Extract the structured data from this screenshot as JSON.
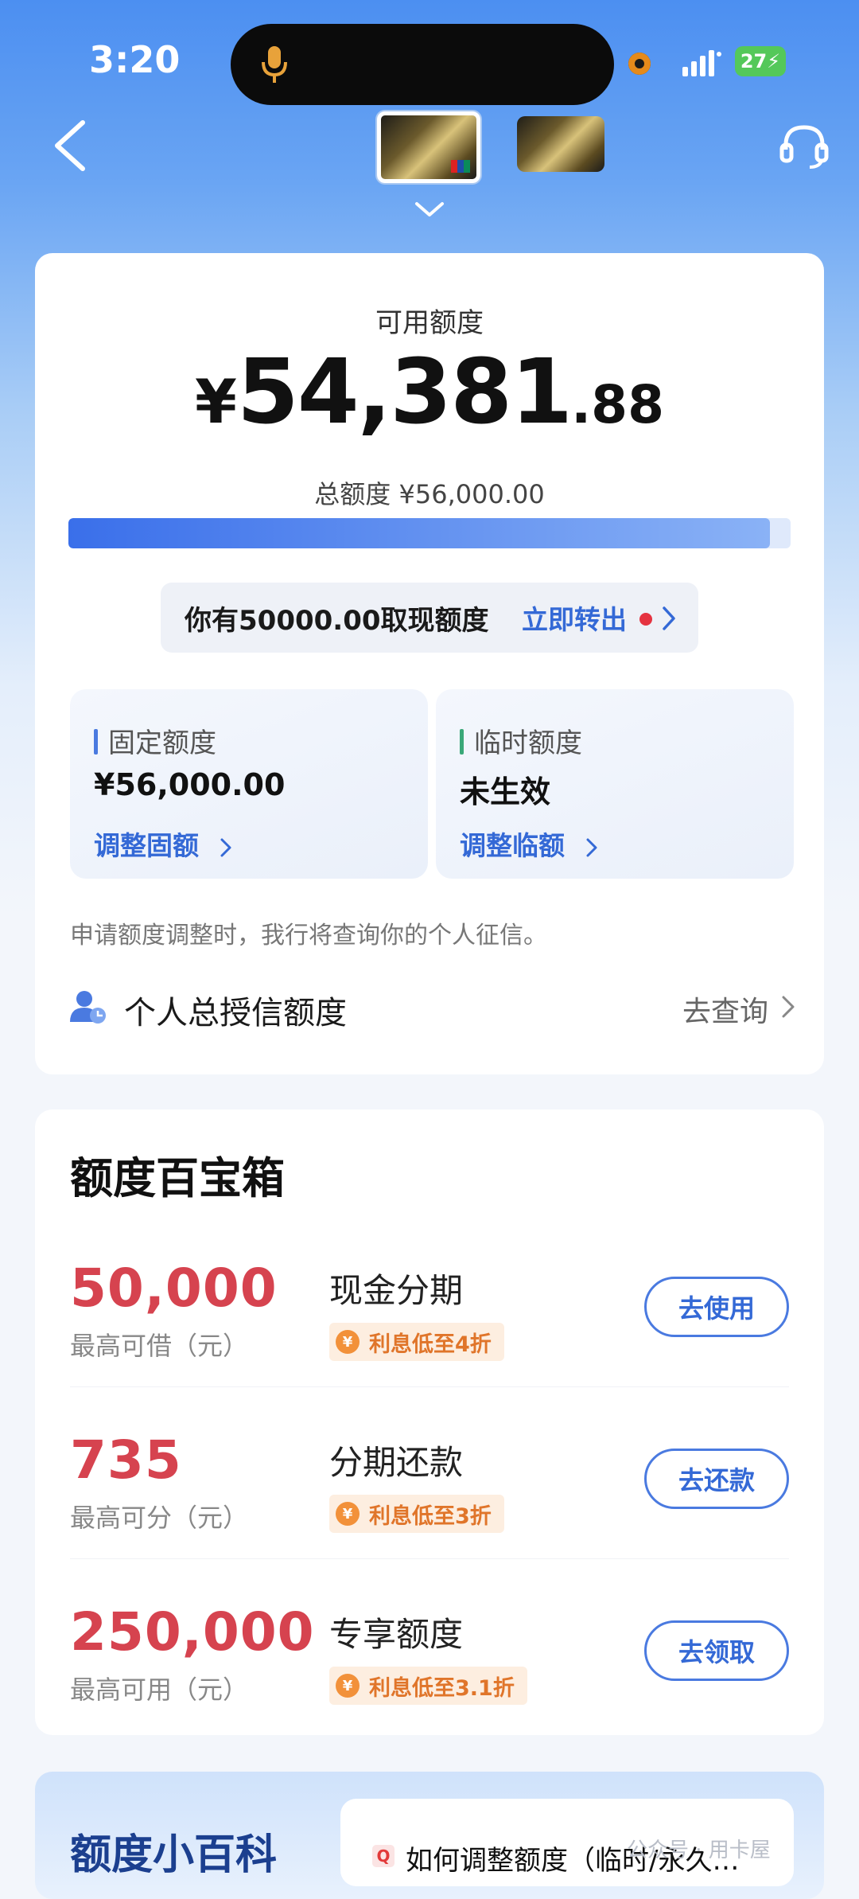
{
  "status_bar": {
    "time": "3:20",
    "battery": "27"
  },
  "header": {
    "back_icon": "chevron-left-icon",
    "cards": [
      "selected-card",
      "other-card"
    ],
    "service_icon": "headset-icon"
  },
  "credit": {
    "available_label": "可用额度",
    "currency": "¥",
    "available_int": "54,381",
    "available_dec": ".88",
    "total_label": "总额度",
    "total_value": "¥56,000.00",
    "used_ratio": 0.971,
    "cash_banner_text": "你有50000.00取现额度",
    "cash_banner_link": "立即转出",
    "fixed": {
      "label": "固定额度",
      "value": "¥56,000.00",
      "link": "调整固额"
    },
    "temporary": {
      "label": "临时额度",
      "value": "未生效",
      "link": "调整临额"
    },
    "notice": "申请额度调整时，我行将查询你的个人征信。",
    "personal_label": "个人总授信额度",
    "personal_link": "去查询"
  },
  "treasure_box": {
    "title": "额度百宝箱",
    "offers": [
      {
        "amount": "50,000",
        "caption": "最高可借（元）",
        "name": "现金分期",
        "tag": "利息低至4折",
        "button": "去使用"
      },
      {
        "amount": "735",
        "caption": "最高可分（元）",
        "name": "分期还款",
        "tag": "利息低至3折",
        "button": "去还款"
      },
      {
        "amount": "250,000",
        "caption": "最高可用（元）",
        "name": "专享额度",
        "tag": "利息低至3.1折",
        "button": "去领取"
      }
    ]
  },
  "encyclopedia": {
    "title": "额度小百科",
    "q_badge": "Q",
    "item": "如何调整额度（临时/永久…"
  },
  "watermark": "公众号 · 用卡屋",
  "colors": {
    "accent": "#3469d6",
    "highlight": "#d6434f",
    "tag": "#e0752a"
  }
}
